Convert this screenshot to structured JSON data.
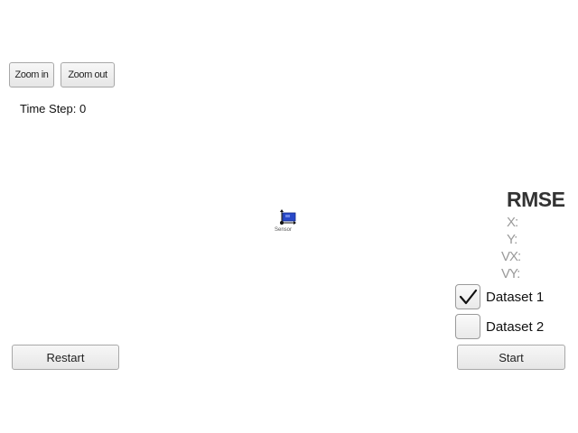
{
  "toolbar": {
    "zoom_in_label": "Zoom in",
    "zoom_out_label": "Zoom out"
  },
  "status": {
    "time_step_text": "Time Step: 0"
  },
  "scene": {
    "car_label": "Sensor",
    "car_color": "#2848c8"
  },
  "rmse": {
    "title": "RMSE",
    "x_label": "X:",
    "y_label": "Y:",
    "vx_label": "VX:",
    "vy_label": "VY:"
  },
  "datasets": [
    {
      "label": "Dataset 1",
      "checked": true
    },
    {
      "label": "Dataset 2",
      "checked": false
    }
  ],
  "controls": {
    "restart_label": "Restart",
    "start_label": "Start"
  }
}
